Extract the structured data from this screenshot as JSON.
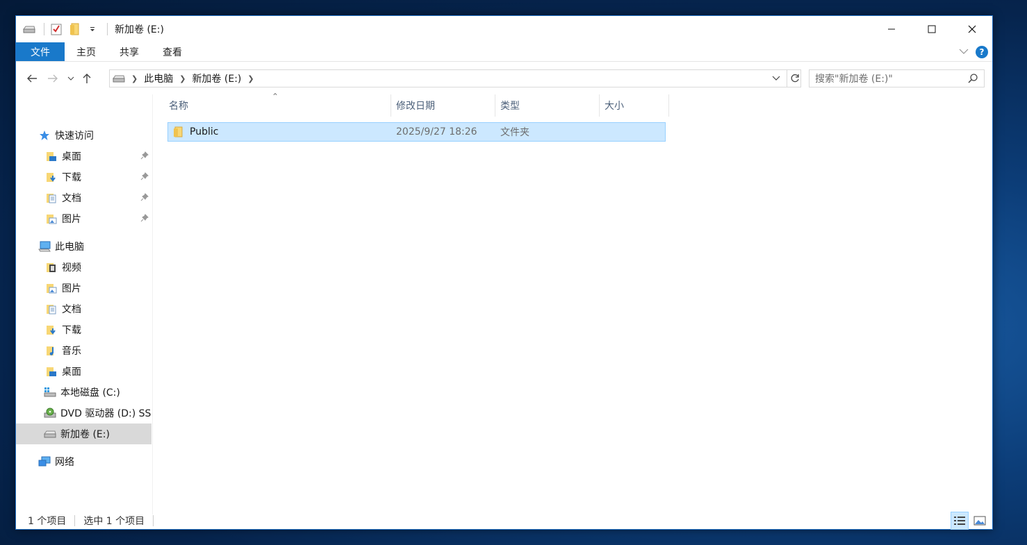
{
  "window": {
    "title": "新加卷 (E:)"
  },
  "ribbon": {
    "tabs": [
      "文件",
      "主页",
      "共享",
      "查看"
    ]
  },
  "address": {
    "crumbs": [
      "此电脑",
      "新加卷 (E:)"
    ]
  },
  "search": {
    "placeholder": "搜索\"新加卷 (E:)\""
  },
  "sidebar": {
    "quick_access": "快速访问",
    "quick_items": [
      "桌面",
      "下载",
      "文档",
      "图片"
    ],
    "this_pc": "此电脑",
    "pc_items": [
      "视频",
      "图片",
      "文档",
      "下载",
      "音乐",
      "桌面",
      "本地磁盘 (C:)",
      "DVD 驱动器 (D:) SS",
      "新加卷 (E:)"
    ],
    "network": "网络"
  },
  "columns": [
    "名称",
    "修改日期",
    "类型",
    "大小"
  ],
  "files": [
    {
      "name": "Public",
      "modified": "2025/9/27 18:26",
      "type": "文件夹",
      "size": ""
    }
  ],
  "status": {
    "count": "1 个项目",
    "selected": "选中 1 个项目"
  },
  "colors": {
    "accent": "#1979ca",
    "selection": "#cce8ff",
    "folder": "#f8d775"
  }
}
